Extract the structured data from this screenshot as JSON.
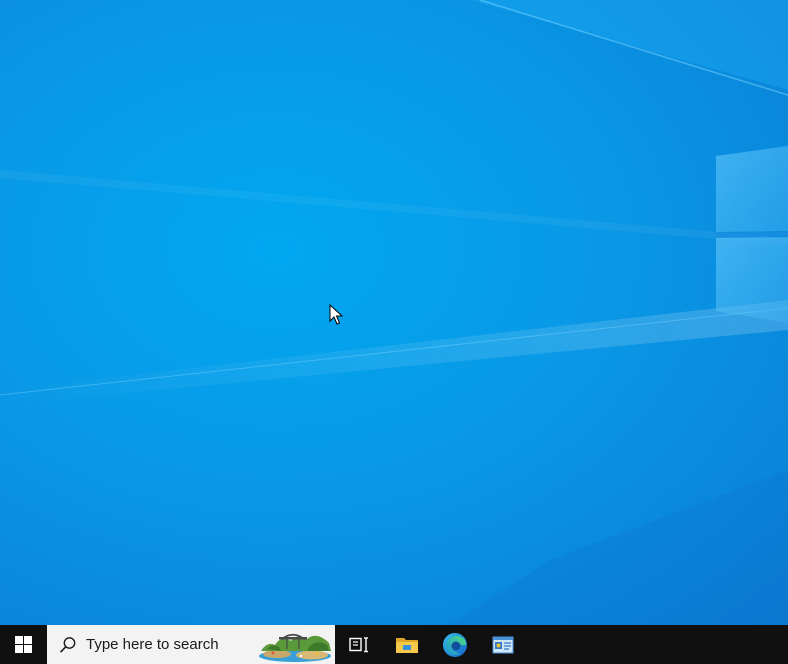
{
  "desktop": {
    "background_color": "#0a98e6"
  },
  "taskbar": {
    "background_color": "#101010",
    "start": {
      "icon": "windows-logo-icon"
    },
    "search": {
      "icon": "search-icon",
      "placeholder": "Type here to search",
      "highlight_icon": "search-highlight-landscape-icon"
    },
    "buttons": [
      {
        "name": "task-view",
        "icon": "task-view-icon"
      },
      {
        "name": "file-explorer",
        "icon": "folder-icon"
      },
      {
        "name": "microsoft-edge",
        "icon": "edge-icon"
      },
      {
        "name": "control-panel",
        "icon": "control-panel-icon"
      }
    ]
  }
}
